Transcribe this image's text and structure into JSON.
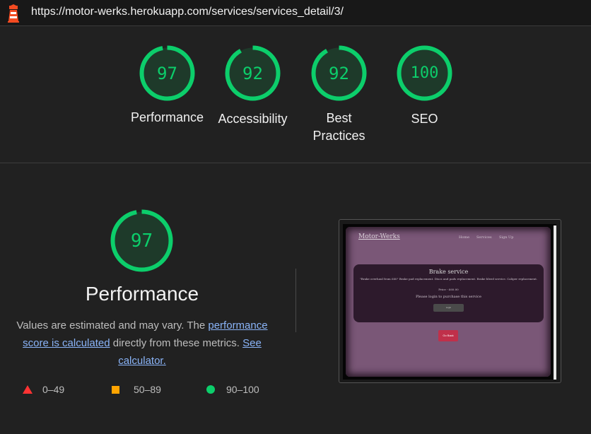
{
  "url": "https://motor-werks.herokuapp.com/services/services_detail/3/",
  "colors": {
    "pass": "#0cce6b",
    "average": "#ffa400",
    "fail": "#ff3333"
  },
  "scores": [
    {
      "value": "97",
      "label": "Performance",
      "fraction": 0.97
    },
    {
      "value": "92",
      "label": "Accessibility",
      "fraction": 0.92
    },
    {
      "value": "92",
      "label": "Best Practices",
      "fraction": 0.92
    },
    {
      "value": "100",
      "label": "SEO",
      "fraction": 1.0
    }
  ],
  "performance": {
    "score": "97",
    "fraction": 0.97,
    "title": "Performance",
    "desc_pre": "Values are estimated and may vary. The ",
    "link1": "performance score is calculated",
    "desc_mid": " directly from these metrics. ",
    "link2": "See calculator.",
    "legend": {
      "fail": "0–49",
      "average": "50–89",
      "pass": "90–100"
    }
  },
  "screenshot": {
    "logo": "Motor-Werks",
    "nav": [
      "Home",
      "Services",
      "Sign Up"
    ],
    "service_title": "Brake service",
    "service_desc": "\"Brake overhaul from £60\" Brake pad replacement. Discs and pads replacement. Brake bleed service. Caliper replacement.",
    "price": "Price - £60.00",
    "login_msg": "Please login to purchase this service",
    "login_btn": "Login",
    "back_btn": "Go Back"
  }
}
